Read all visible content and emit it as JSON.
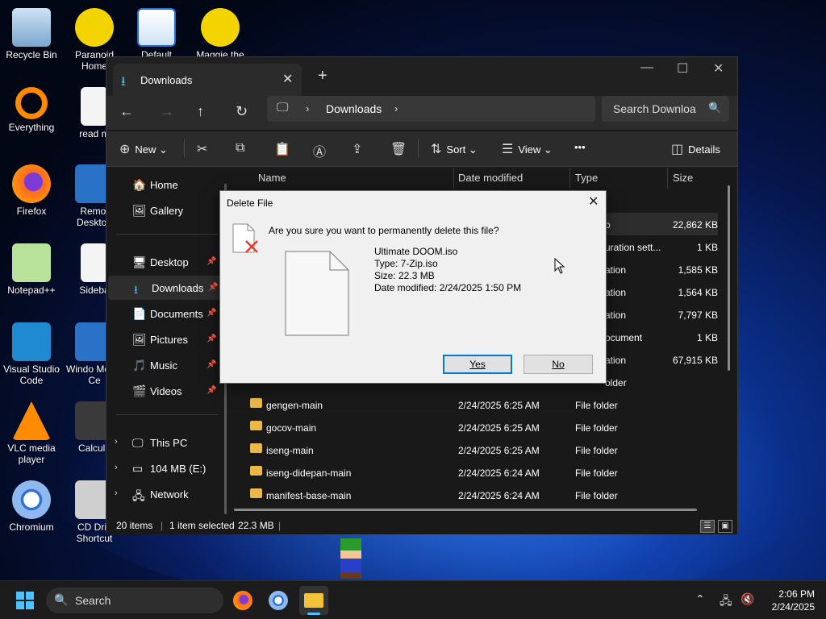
{
  "desktop": {
    "icons": [
      {
        "label": "Recycle Bin"
      },
      {
        "label": "Paranoid Home"
      },
      {
        "label": "Default"
      },
      {
        "label": "Maggie the"
      },
      {
        "label": "Everything"
      },
      {
        "label": "read m"
      },
      {
        "label": "Firefox"
      },
      {
        "label": "Remot Desktop"
      },
      {
        "label": "Notepad++"
      },
      {
        "label": "Sideba"
      },
      {
        "label": "Visual Studio Code"
      },
      {
        "label": "Windo Media Ce"
      },
      {
        "label": "VLC media player"
      },
      {
        "label": "Calcula"
      },
      {
        "label": "Chromium"
      },
      {
        "label": "CD Driv Shortcut"
      }
    ]
  },
  "explorer": {
    "tab_title": "Downloads",
    "tab_close": "✕",
    "new_tab": "+",
    "breadcrumb": "Downloads",
    "search_placeholder": "Search Downloa",
    "commands": {
      "new": "New",
      "sort": "Sort",
      "view": "View",
      "more": "•••",
      "details": "Details"
    },
    "sidebar": {
      "home": "Home",
      "gallery": "Gallery",
      "desktop": "Desktop",
      "downloads": "Downloads",
      "documents": "Documents",
      "pictures": "Pictures",
      "music": "Music",
      "videos": "Videos",
      "this_pc": "This PC",
      "drive": "104 MB (E:)",
      "network": "Network"
    },
    "columns": {
      "name": "Name",
      "date": "Date modified",
      "type": "Type",
      "size": "Size"
    },
    "partial_rows": [
      {
        "type": "o",
        "size": "22,862 KB"
      },
      {
        "type": "uration sett...",
        "size": "1 KB"
      },
      {
        "type": "ation",
        "size": "1,585 KB"
      },
      {
        "type": "ation",
        "size": "1,564 KB"
      },
      {
        "type": "ation",
        "size": "7,797 KB"
      },
      {
        "type": "ocument",
        "size": "1 KB"
      },
      {
        "type": "ation",
        "size": "67,915 KB"
      },
      {
        "type": "older",
        "size": ""
      }
    ],
    "rows": [
      {
        "name": "gengen-main",
        "date": "2/24/2025 6:25 AM",
        "type": "File folder"
      },
      {
        "name": "gocov-main",
        "date": "2/24/2025 6:25 AM",
        "type": "File folder"
      },
      {
        "name": "iseng-main",
        "date": "2/24/2025 6:25 AM",
        "type": "File folder"
      },
      {
        "name": "iseng-didepan-main",
        "date": "2/24/2025 6:24 AM",
        "type": "File folder"
      },
      {
        "name": "manifest-base-main",
        "date": "2/24/2025 6:24 AM",
        "type": "File folder"
      }
    ],
    "status": {
      "items": "20 items",
      "selected": "1 item selected",
      "size": "22.3 MB"
    }
  },
  "dialog": {
    "title": "Delete File",
    "question": "Are you sure you want to permanently delete this file?",
    "file_name": "Ultimate DOOM.iso",
    "file_type": "Type: 7-Zip.iso",
    "file_size": "Size: 22.3 MB",
    "file_date": "Date modified: 2/24/2025 1:50 PM",
    "yes": "Yes",
    "no": "No"
  },
  "taskbar": {
    "search": "Search",
    "time": "2:06 PM",
    "date": "2/24/2025"
  },
  "colors": {
    "accent": "#0078d7",
    "folder": "#e8b84a",
    "explorer_bg": "#191919"
  }
}
